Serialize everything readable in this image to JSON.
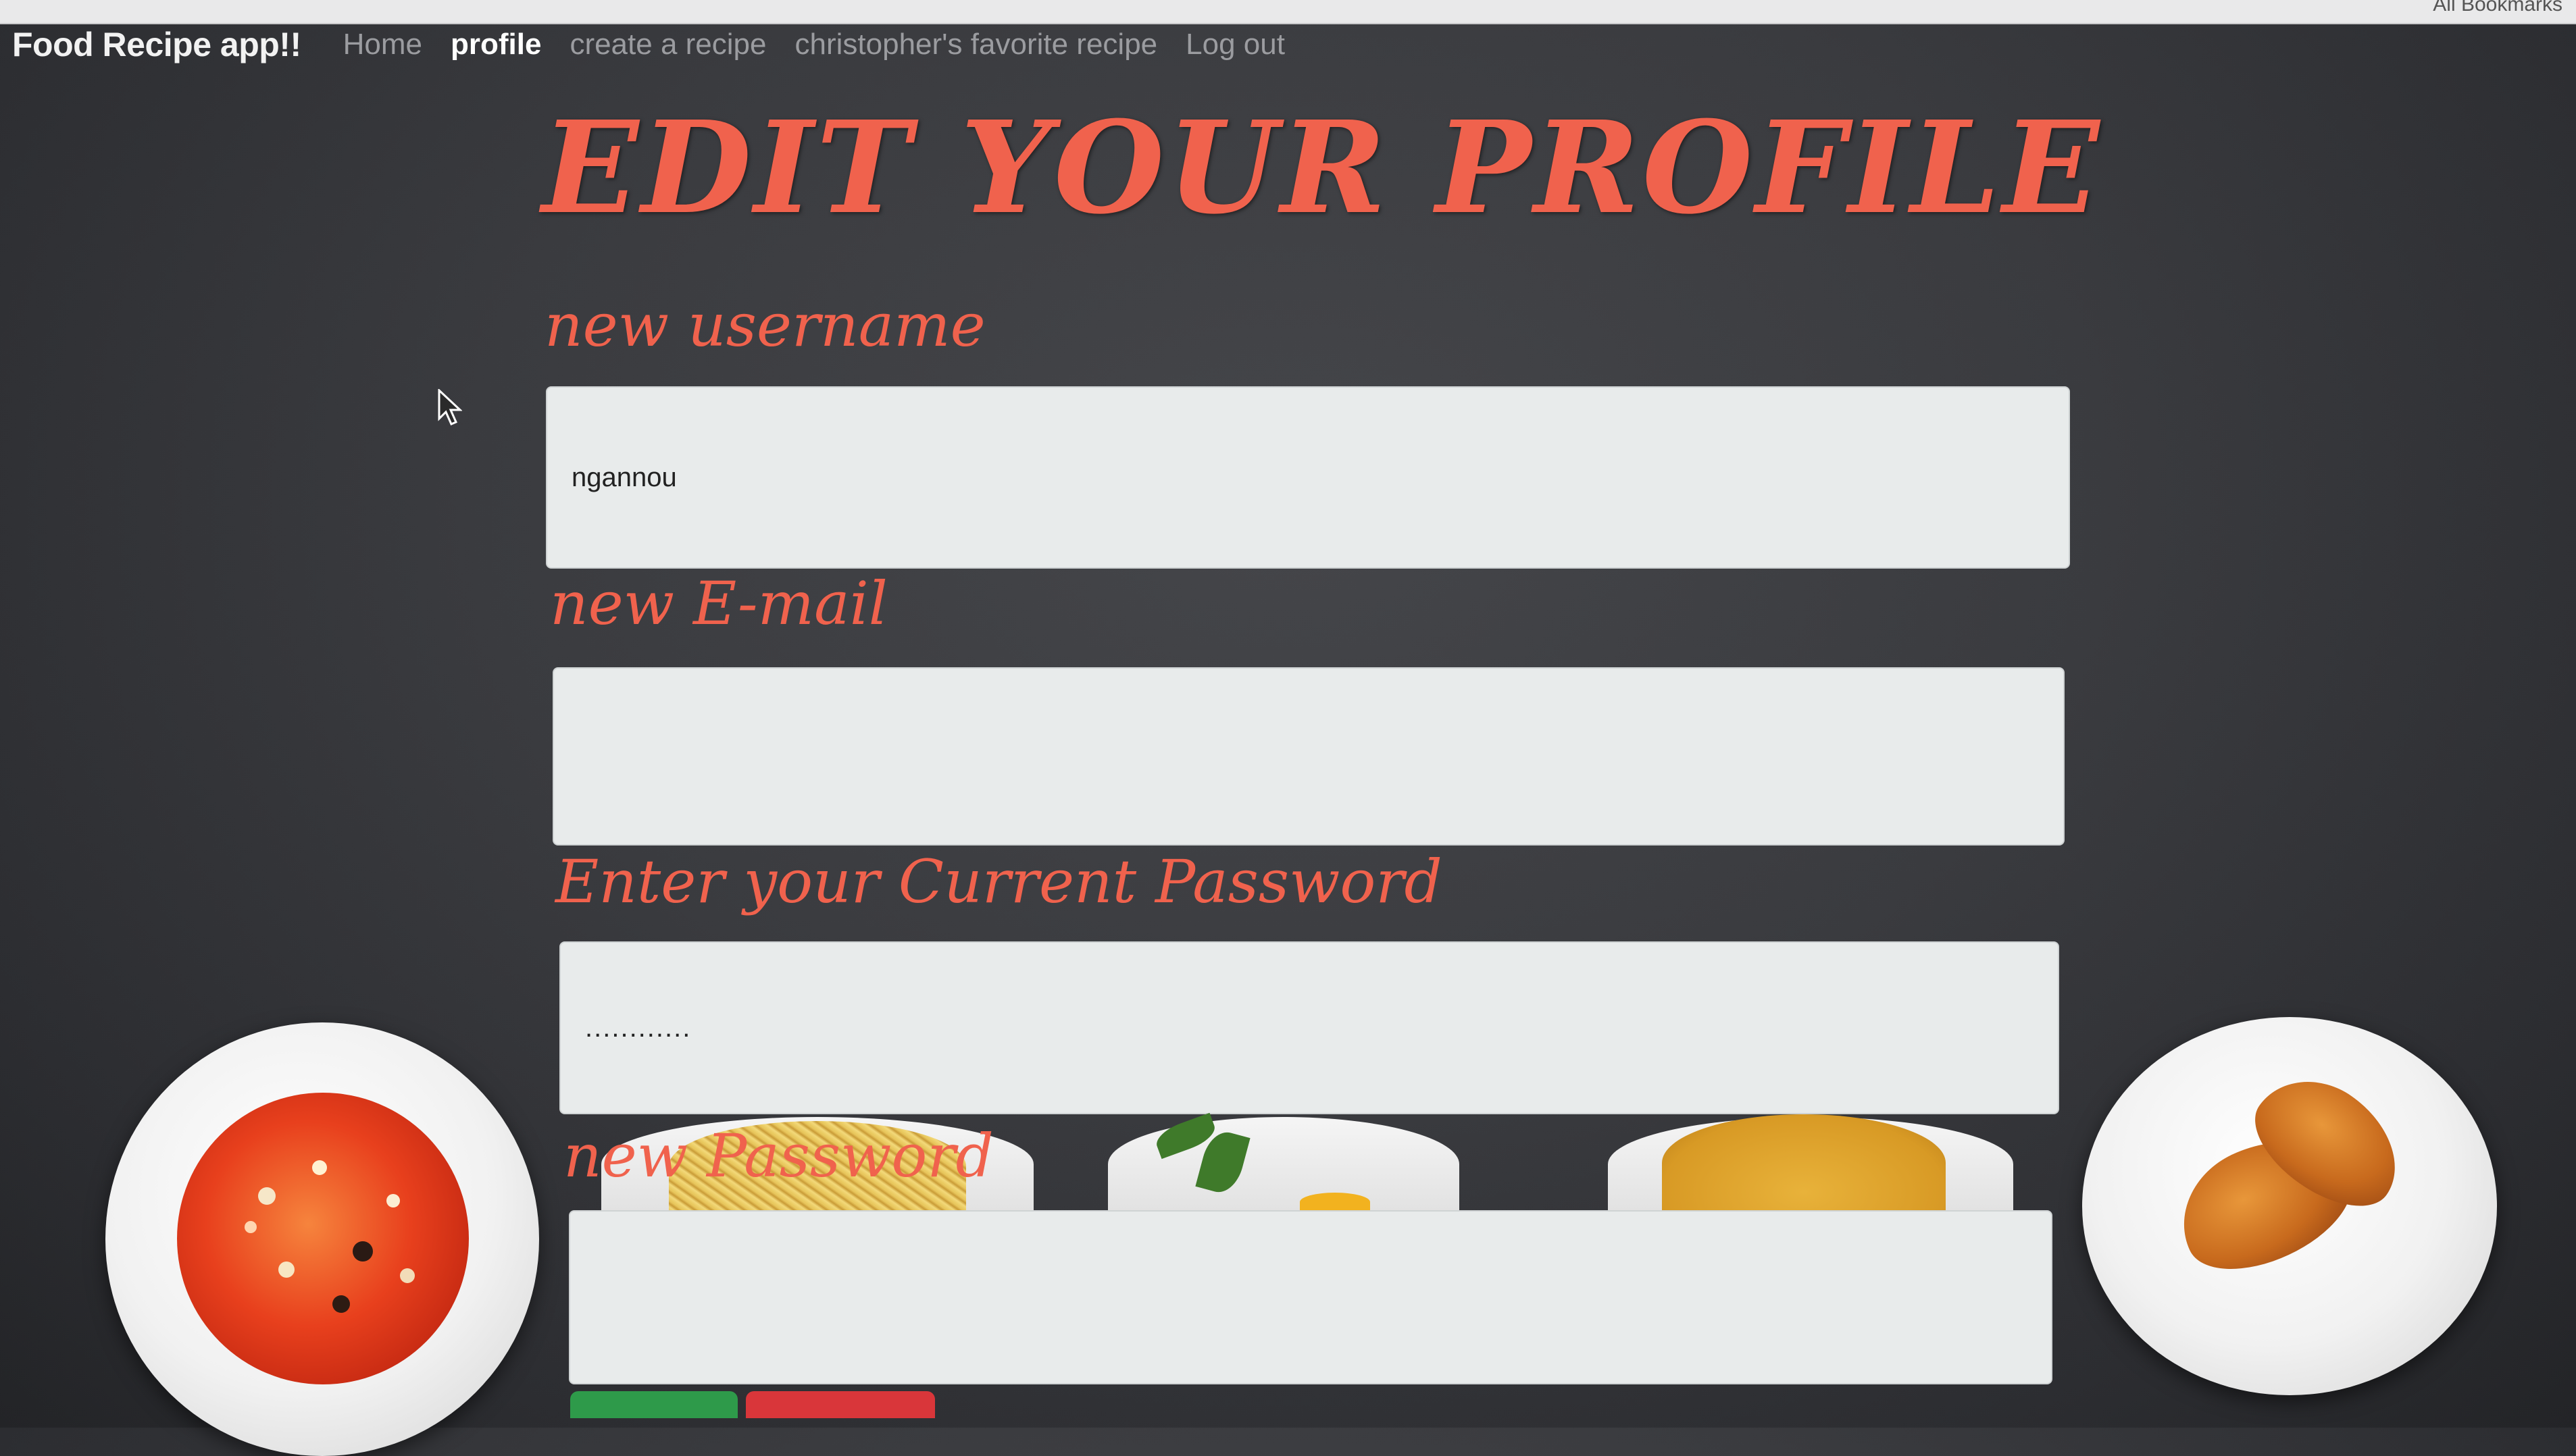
{
  "browser": {
    "bookmarks_label": "All Bookmarks"
  },
  "nav": {
    "brand": "Food Recipe app!!",
    "links": [
      {
        "label": "Home"
      },
      {
        "label": "profile"
      },
      {
        "label": "create a recipe"
      },
      {
        "label": "christopher's favorite recipe"
      },
      {
        "label": "Log out"
      }
    ],
    "active": "profile"
  },
  "page": {
    "title": "EDIT YOUR PROFILE"
  },
  "form": {
    "username": {
      "label": "new username",
      "value": "ngannou"
    },
    "email": {
      "label": "new E-mail",
      "value": ""
    },
    "current_password": {
      "label": "Enter your Current Password",
      "value": "............"
    },
    "new_password": {
      "label": "new Password",
      "value": ""
    }
  },
  "colors": {
    "accent": "#f0624d",
    "nav_text": "#9b9ca0",
    "nav_active": "#ffffff",
    "input_bg": "#e8ebeb",
    "submit_green": "#2e9a4a",
    "cancel_red": "#d9363a"
  }
}
